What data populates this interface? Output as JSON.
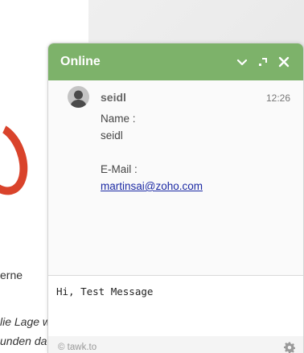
{
  "background": {
    "line1": "erne",
    "line2": "lie Lage w",
    "line3": "unden da"
  },
  "chat": {
    "status": "Online",
    "header_buttons": [
      "minimize-icon",
      "popout-icon",
      "close-icon"
    ],
    "message": {
      "sender": "seidl",
      "time": "12:26",
      "lines": {
        "name_label": "Name :",
        "name_value": "seidl",
        "email_label": "E-Mail :",
        "email_value": "martinsai@zoho.com"
      }
    },
    "compose_value": "Hi, Test Message",
    "branding": "© tawk.to"
  },
  "colors": {
    "header": "#7db26a",
    "link": "#1c2aa4"
  }
}
